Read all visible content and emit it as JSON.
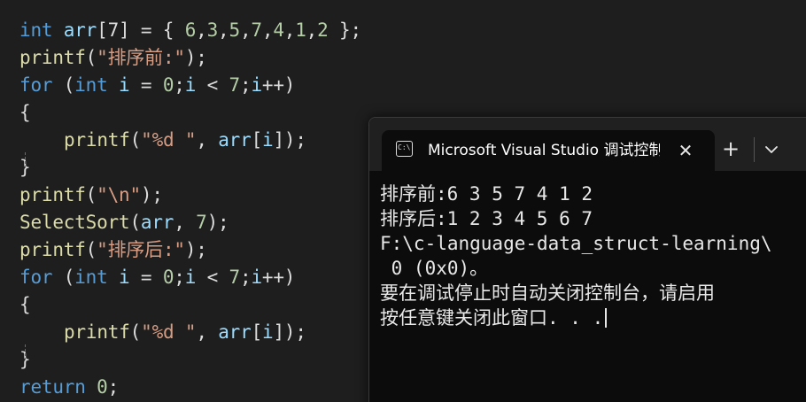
{
  "editor": {
    "lines": [
      [
        [
          "kw",
          "int"
        ],
        [
          "pl",
          " "
        ],
        [
          "vr",
          "arr"
        ],
        [
          "pl",
          "[7] = { "
        ],
        [
          "nm",
          "6"
        ],
        [
          "pl",
          ","
        ],
        [
          "nm",
          "3"
        ],
        [
          "pl",
          ","
        ],
        [
          "nm",
          "5"
        ],
        [
          "pl",
          ","
        ],
        [
          "nm",
          "7"
        ],
        [
          "pl",
          ","
        ],
        [
          "nm",
          "4"
        ],
        [
          "pl",
          ","
        ],
        [
          "nm",
          "1"
        ],
        [
          "pl",
          ","
        ],
        [
          "nm",
          "2"
        ],
        [
          "pl",
          " };"
        ]
      ],
      [
        [
          "fn",
          "printf"
        ],
        [
          "pl",
          "("
        ],
        [
          "st",
          "\"排序前:\""
        ],
        [
          "pl",
          ");"
        ]
      ],
      [
        [
          "kw",
          "for"
        ],
        [
          "pl",
          " ("
        ],
        [
          "kw",
          "int"
        ],
        [
          "pl",
          " "
        ],
        [
          "vr",
          "i"
        ],
        [
          "pl",
          " = "
        ],
        [
          "nm",
          "0"
        ],
        [
          "pl",
          ";"
        ],
        [
          "vr",
          "i"
        ],
        [
          "pl",
          " < "
        ],
        [
          "nm",
          "7"
        ],
        [
          "pl",
          ";"
        ],
        [
          "vr",
          "i"
        ],
        [
          "pl",
          "++)"
        ]
      ],
      [
        [
          "pl",
          "{"
        ]
      ],
      [
        [
          "indent",
          ""
        ],
        [
          "fn",
          "printf"
        ],
        [
          "pl",
          "("
        ],
        [
          "st",
          "\"%d \""
        ],
        [
          "pl",
          ", "
        ],
        [
          "vr",
          "arr"
        ],
        [
          "pl",
          "["
        ],
        [
          "vr",
          "i"
        ],
        [
          "pl",
          "]);"
        ]
      ],
      [
        [
          "pl",
          "}"
        ]
      ],
      [
        [
          "fn",
          "printf"
        ],
        [
          "pl",
          "("
        ],
        [
          "st",
          "\"\\n\""
        ],
        [
          "pl",
          ");"
        ]
      ],
      [
        [
          "fn",
          "SelectSort"
        ],
        [
          "pl",
          "("
        ],
        [
          "vr",
          "arr"
        ],
        [
          "pl",
          ", "
        ],
        [
          "nm",
          "7"
        ],
        [
          "pl",
          ");"
        ]
      ],
      [
        [
          "fn",
          "printf"
        ],
        [
          "pl",
          "("
        ],
        [
          "st",
          "\"排序后:\""
        ],
        [
          "pl",
          ");"
        ]
      ],
      [
        [
          "kw",
          "for"
        ],
        [
          "pl",
          " ("
        ],
        [
          "kw",
          "int"
        ],
        [
          "pl",
          " "
        ],
        [
          "vr",
          "i"
        ],
        [
          "pl",
          " = "
        ],
        [
          "nm",
          "0"
        ],
        [
          "pl",
          ";"
        ],
        [
          "vr",
          "i"
        ],
        [
          "pl",
          " < "
        ],
        [
          "nm",
          "7"
        ],
        [
          "pl",
          ";"
        ],
        [
          "vr",
          "i"
        ],
        [
          "pl",
          "++)"
        ]
      ],
      [
        [
          "pl",
          "{"
        ]
      ],
      [
        [
          "indent",
          ""
        ],
        [
          "fn",
          "printf"
        ],
        [
          "pl",
          "("
        ],
        [
          "st",
          "\"%d \""
        ],
        [
          "pl",
          ", "
        ],
        [
          "vr",
          "arr"
        ],
        [
          "pl",
          "["
        ],
        [
          "vr",
          "i"
        ],
        [
          "pl",
          "]);"
        ]
      ],
      [
        [
          "pl",
          "}"
        ]
      ],
      [
        [
          "kw",
          "return"
        ],
        [
          "pl",
          " "
        ],
        [
          "nm",
          "0"
        ],
        [
          "pl",
          ";"
        ]
      ]
    ]
  },
  "terminal": {
    "tab_icon_text": "C:\\",
    "tab_title": "Microsoft Visual Studio 调试控制台",
    "close_glyph": "✕",
    "new_tab_glyph": "+",
    "dropdown_icon": "chevron-down-icon",
    "output_lines": [
      "排序前:6 3 5 7 4 1 2",
      "排序后:1 2 3 4 5 6 7",
      "F:\\c-language-data_struct-learning\\",
      " 0 (0x0)。",
      "要在调试停止时自动关闭控制台，请启用",
      "按任意键关闭此窗口. . ."
    ]
  },
  "colors": {
    "editor_bg": "#1e1e1e",
    "keyword": "#569cd6",
    "function": "#dcdcaa",
    "variable": "#9cdcfe",
    "number": "#b5cea8",
    "string": "#d69d85",
    "terminal_bg": "#0c0c0c",
    "tabbar_bg": "#202020"
  }
}
